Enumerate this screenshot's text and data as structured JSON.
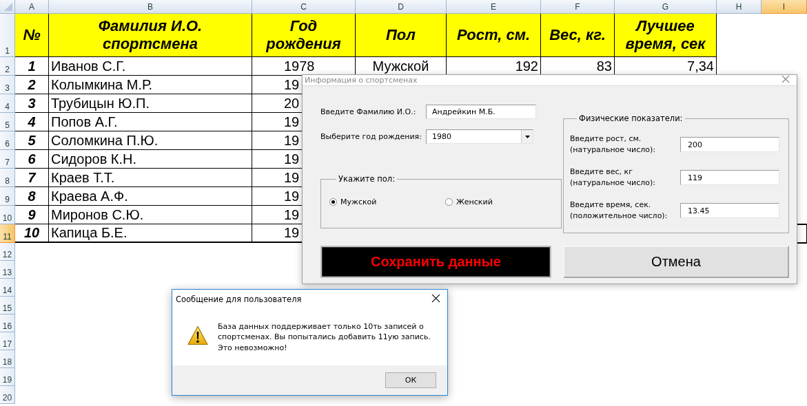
{
  "sheet": {
    "columns": [
      {
        "label": "A",
        "selected": false
      },
      {
        "label": "B",
        "selected": false
      },
      {
        "label": "C",
        "selected": false
      },
      {
        "label": "D",
        "selected": false
      },
      {
        "label": "E",
        "selected": false
      },
      {
        "label": "F",
        "selected": false
      },
      {
        "label": "G",
        "selected": false
      },
      {
        "label": "H",
        "selected": false
      },
      {
        "label": "I",
        "selected": true
      }
    ],
    "row_headers": [
      {
        "label": "1",
        "selected": false
      },
      {
        "label": "2",
        "selected": false
      },
      {
        "label": "3",
        "selected": false
      },
      {
        "label": "4",
        "selected": false
      },
      {
        "label": "5",
        "selected": false
      },
      {
        "label": "6",
        "selected": false
      },
      {
        "label": "7",
        "selected": false
      },
      {
        "label": "8",
        "selected": false
      },
      {
        "label": "9",
        "selected": false
      },
      {
        "label": "10",
        "selected": false
      },
      {
        "label": "11",
        "selected": true
      },
      {
        "label": "12",
        "selected": false
      },
      {
        "label": "13",
        "selected": false
      },
      {
        "label": "14",
        "selected": false
      },
      {
        "label": "15",
        "selected": false
      },
      {
        "label": "16",
        "selected": false
      },
      {
        "label": "17",
        "selected": false
      },
      {
        "label": "18",
        "selected": false
      },
      {
        "label": "19",
        "selected": false
      },
      {
        "label": "20",
        "selected": false
      }
    ],
    "table_header": [
      "№",
      "Фамилия И.О. спортсмена",
      "Год рождения",
      "Пол",
      "Рост, см.",
      "Вес, кг.",
      "Лучшее время, сек"
    ],
    "table_rows": [
      {
        "number": "1",
        "cells": [
          "Иванов С.Г.",
          "1978",
          "Мужской",
          "192",
          "83",
          "7,34"
        ]
      },
      {
        "number": "2",
        "cells": [
          "Колымкина М.Р.",
          "19"
        ]
      },
      {
        "number": "3",
        "cells": [
          "Трубицын Ю.П.",
          "20"
        ]
      },
      {
        "number": "4",
        "cells": [
          "Попов А.Г.",
          "19"
        ]
      },
      {
        "number": "5",
        "cells": [
          "Соломкина П.Ю.",
          "19"
        ]
      },
      {
        "number": "6",
        "cells": [
          "Сидоров К.Н.",
          "19"
        ]
      },
      {
        "number": "7",
        "cells": [
          "Краев Т.Т.",
          "19"
        ]
      },
      {
        "number": "8",
        "cells": [
          "Краева А.Ф.",
          "19"
        ]
      },
      {
        "number": "9",
        "cells": [
          "Миронов С.Ю.",
          "19"
        ]
      },
      {
        "number": "10",
        "cells": [
          "Капица Б.Е.",
          "19"
        ]
      }
    ]
  },
  "form_dialog": {
    "title": "Информация о спортсменах",
    "name_label": "Введите Фамилию И.О.:",
    "name_value": "Андрейкин М.Б.",
    "year_label": "Выберите год рождения:",
    "year_value": "1980",
    "gender_group": {
      "legend": "Укажите пол:",
      "options": [
        {
          "label": "Мужской",
          "selected": true
        },
        {
          "label": "Женский",
          "selected": false
        }
      ]
    },
    "physical_group": {
      "legend": "Физические показатели:",
      "fields": [
        {
          "label": "Введите рост, см.\n(натуральное число):",
          "value": "200"
        },
        {
          "label": "Введите вес, кг\n(натуральное число):",
          "value": "119"
        },
        {
          "label": "Введите время, сек.\n(положительное число):",
          "value": "13.45"
        }
      ]
    },
    "save_button": "Сохранить данные",
    "cancel_button": "Отмена"
  },
  "message_box": {
    "title": "Сообщение для пользователя",
    "message": "База данных поддерживает только 10ть записей о спортсменах. Вы попытались добавить 11ую запись. Это невозможно!",
    "button": "ОК"
  }
}
